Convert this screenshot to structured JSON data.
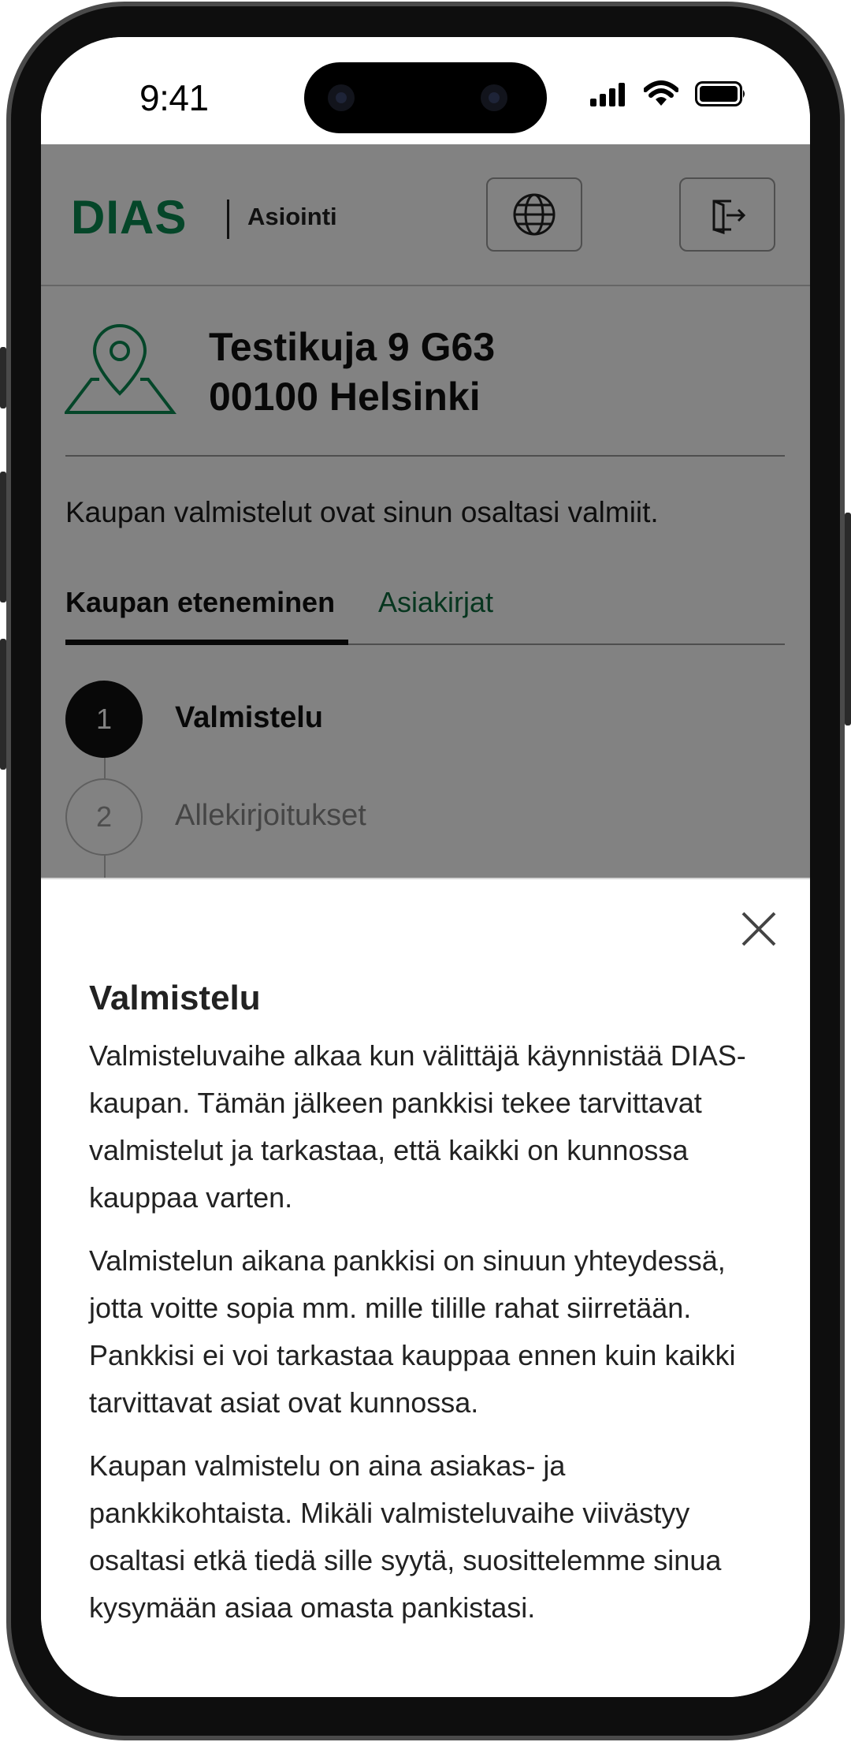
{
  "status_bar": {
    "time": "9:41",
    "icons": [
      "signal-icon",
      "wifi-icon",
      "battery-icon"
    ]
  },
  "header": {
    "logo": "DIAS",
    "app_name": "Asiointi",
    "language_button_icon": "globe-icon",
    "logout_button_icon": "logout-icon"
  },
  "property": {
    "icon": "map-pin-icon",
    "address_line1": "Testikuja 9 G63",
    "address_line2": "00100 Helsinki"
  },
  "status_message": "Kaupan valmistelut ovat sinun osaltasi valmiit.",
  "tabs": [
    {
      "label": "Kaupan eteneminen",
      "active": true
    },
    {
      "label": "Asiakirjat",
      "active": false
    }
  ],
  "steps": [
    {
      "number": "1",
      "label": "Valmistelu",
      "active": true
    },
    {
      "number": "2",
      "label": "Allekirjoitukset",
      "active": false
    }
  ],
  "sheet": {
    "close_icon": "close-icon",
    "title": "Valmistelu",
    "paragraphs": [
      "Valmisteluvaihe alkaa kun välittäjä käynnistää DIAS-kaupan. Tämän jälkeen pankkisi tekee tarvittavat valmistelut ja tarkastaa, että kaikki on kunnossa kauppaa varten.",
      "Valmistelun aikana pankkisi on sinuun yhteydessä, jotta voitte sopia mm. mille tilille rahat siirretään. Pankkisi ei voi tarkastaa kauppaa ennen kuin kaikki tarvittavat asiat ovat kunnossa.",
      "Kaupan valmistelu on aina asiakas- ja pankkikohtaista. Mikäli valmisteluvaihe viivästyy osaltasi etkä tiedä sille syytä, suosittelemme sinua kysymään asiaa omasta pankistasi."
    ]
  },
  "colors": {
    "brand_green": "#0a8a52",
    "link_green": "#0e6a3e",
    "overlay": "rgba(0,0,0,0.49)"
  }
}
